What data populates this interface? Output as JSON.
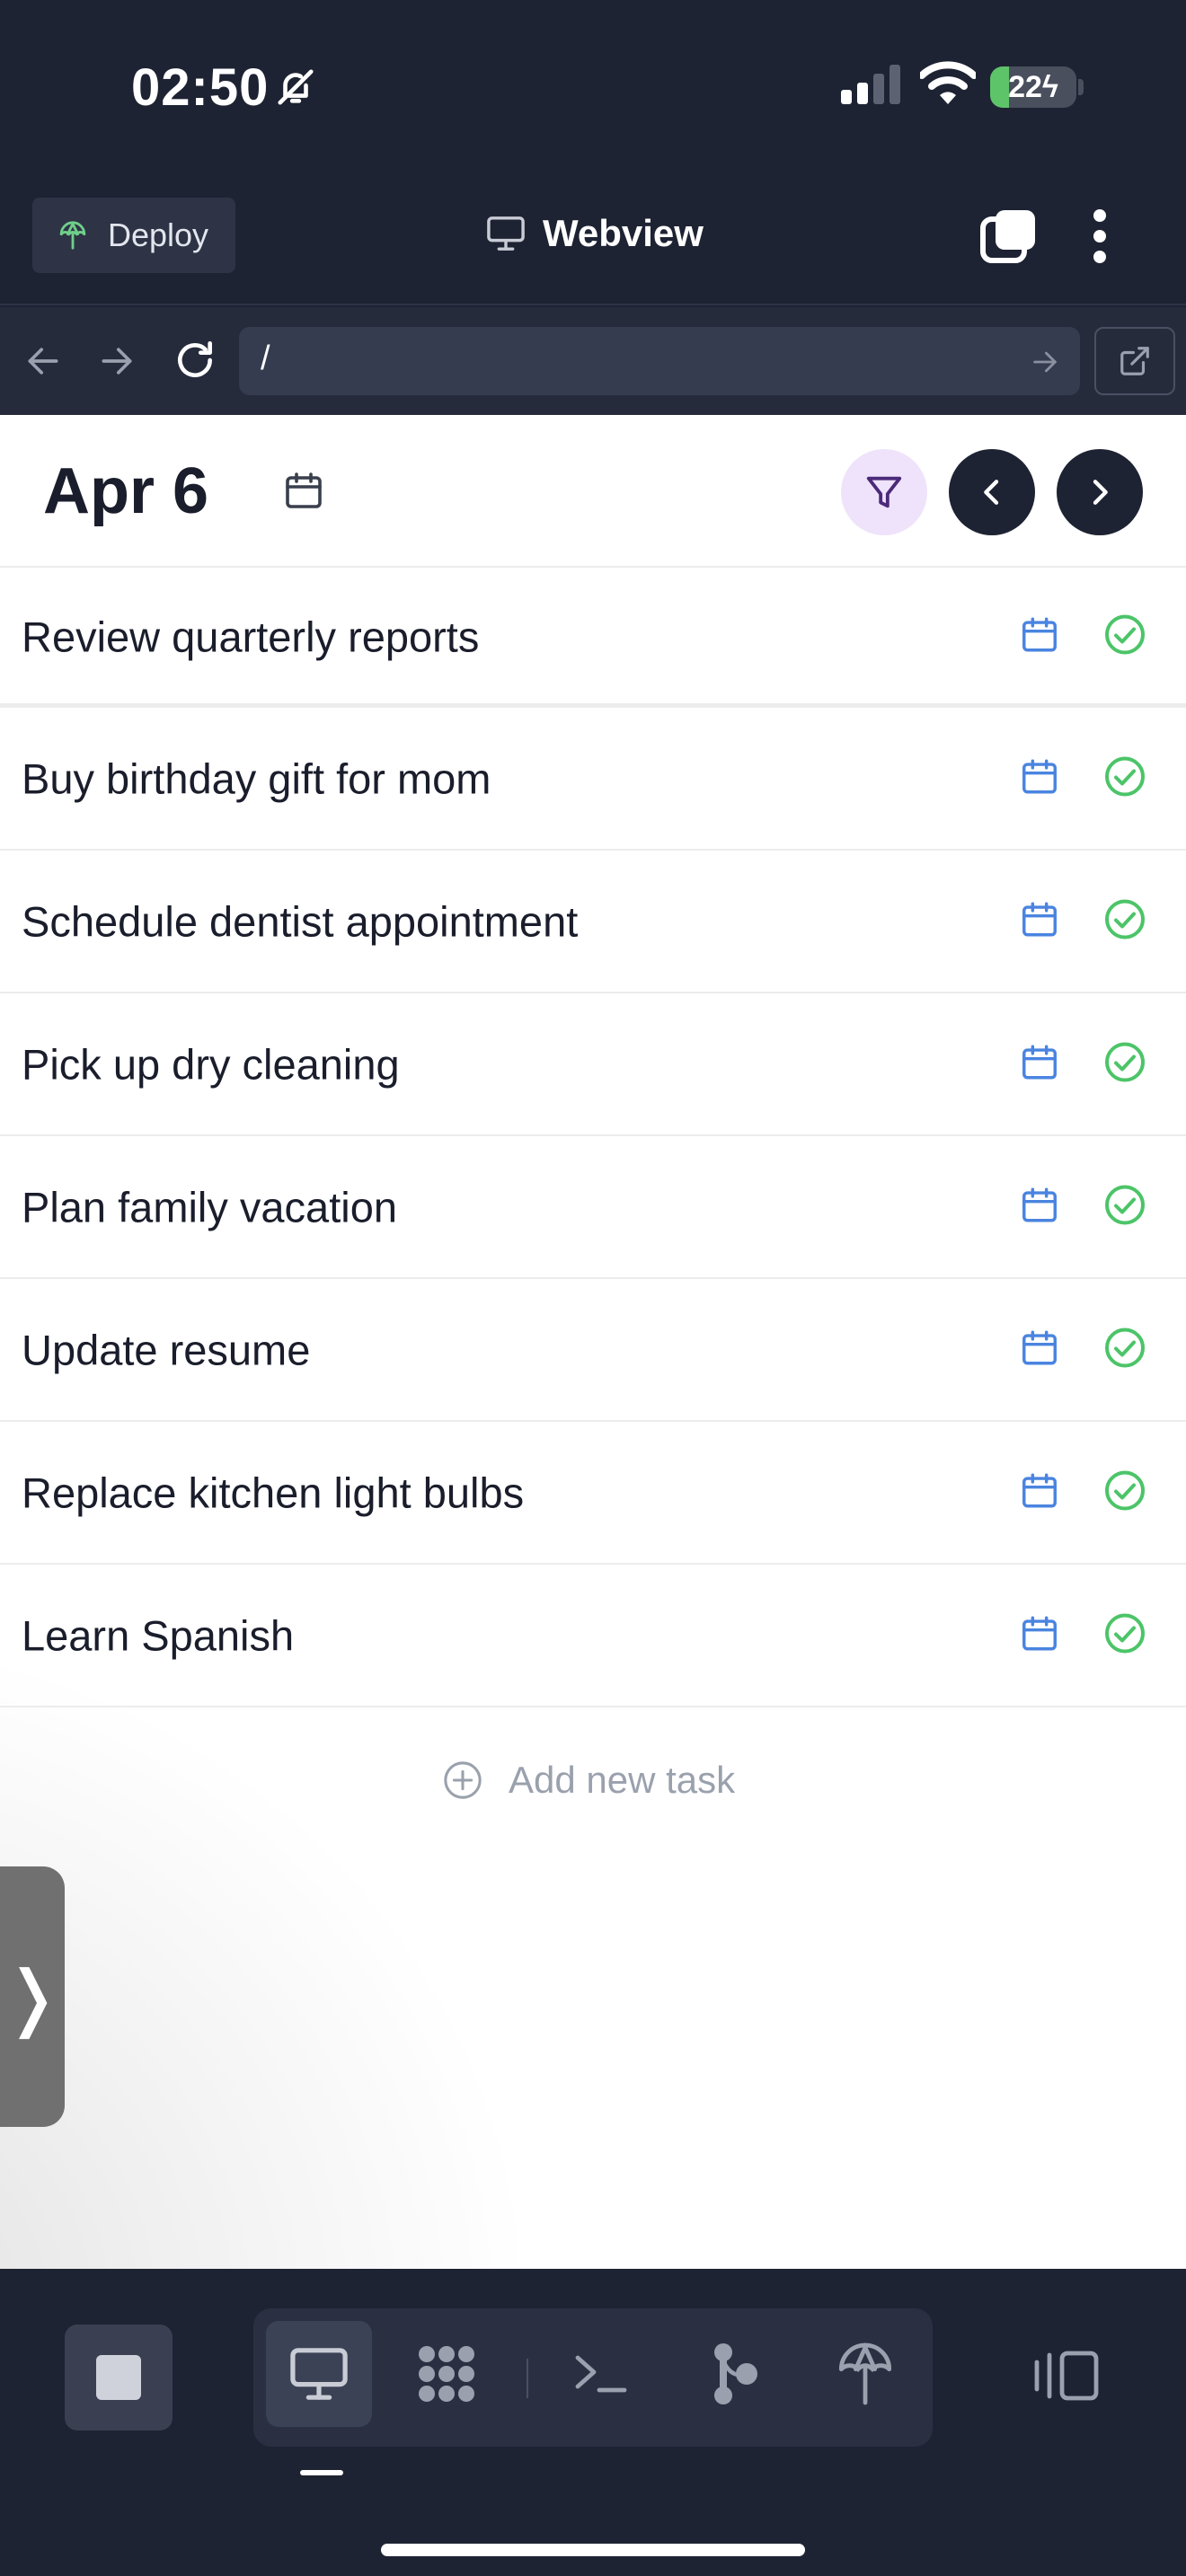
{
  "status_bar": {
    "time": "02:50",
    "battery_level": "22",
    "icons": [
      "bell-slash-icon",
      "signal-icon",
      "wifi-icon",
      "battery-charging-icon"
    ]
  },
  "header": {
    "deploy_label": "Deploy",
    "title": "Webview"
  },
  "url_bar": {
    "url": "/"
  },
  "page": {
    "date": "Apr 6",
    "tasks": [
      {
        "label": "Review quarterly reports"
      },
      {
        "label": "Buy birthday gift for mom"
      },
      {
        "label": "Schedule dentist appointment"
      },
      {
        "label": "Pick up dry cleaning"
      },
      {
        "label": "Plan family vacation"
      },
      {
        "label": "Update resume"
      },
      {
        "label": "Replace kitchen light bulbs"
      },
      {
        "label": "Learn Spanish"
      }
    ],
    "add_task_label": "Add new task",
    "side_handle_glyph": "❭"
  },
  "colors": {
    "accent_blue": "#4a84e0",
    "check_green": "#4cc468",
    "filter_purple": "#4b2a7a",
    "dark": "#1e2333"
  }
}
